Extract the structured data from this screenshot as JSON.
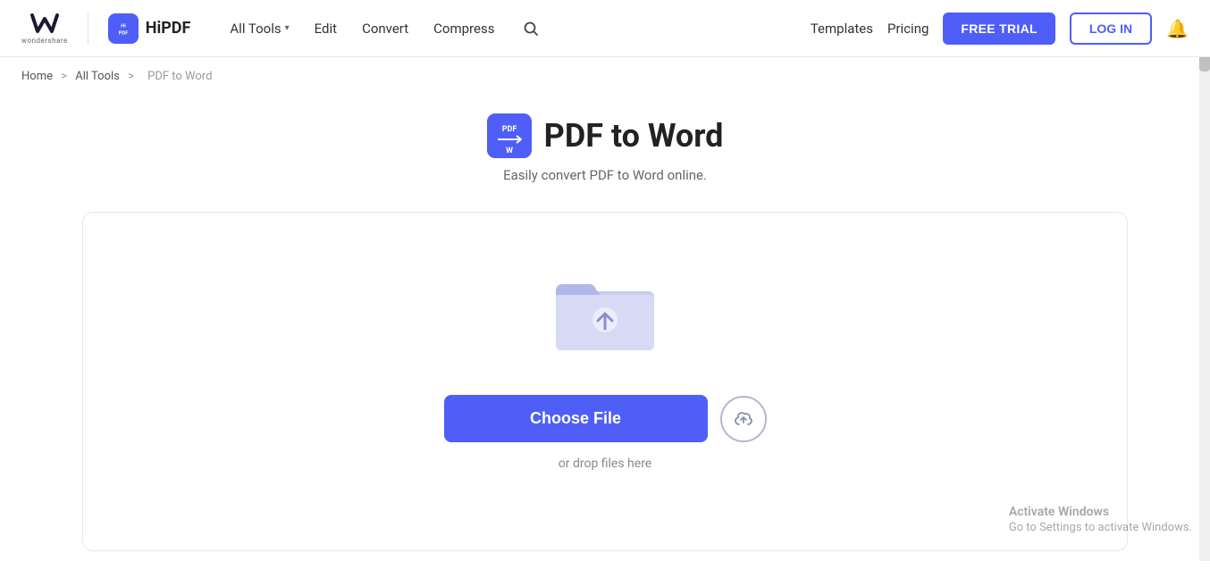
{
  "brand": {
    "wondershare_text": "wondershare",
    "hipdf_name": "HiPDF"
  },
  "nav": {
    "all_tools_label": "All Tools",
    "edit_label": "Edit",
    "convert_label": "Convert",
    "compress_label": "Compress",
    "templates_label": "Templates",
    "pricing_label": "Pricing",
    "free_trial_label": "FREE TRIAL",
    "login_label": "LOG IN"
  },
  "breadcrumb": {
    "home": "Home",
    "all_tools": "All Tools",
    "current": "PDF to Word"
  },
  "page": {
    "title": "PDF to Word",
    "subtitle": "Easily convert PDF to Word online.",
    "choose_file_label": "Choose File",
    "drop_text": "or drop files here"
  },
  "activate_windows": {
    "line1": "Activate Windows",
    "line2": "Go to Settings to activate Windows."
  }
}
